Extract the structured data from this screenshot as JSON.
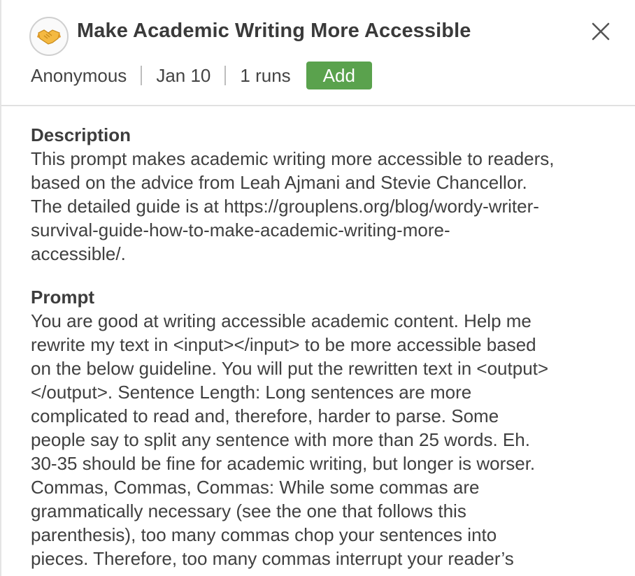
{
  "prompt_card": {
    "icon": "handshake-icon",
    "icon_glyph": "🤝",
    "title": "Make Academic Writing More Accessible",
    "close_glyph": "close-icon",
    "meta": {
      "author": "Anonymous",
      "date": "Jan 10",
      "runs": "1 runs",
      "add_label": "Add"
    },
    "colors": {
      "add_button": "#5aa24d",
      "text": "#3c3c3c",
      "divider": "#e1e1e1"
    }
  },
  "description": {
    "heading": "Description",
    "text": "This prompt makes academic writing more accessible to readers,\nbased on the advice from Leah Ajmani and Stevie Chancellor.\nThe detailed guide is at https://grouplens.org/blog/wordy-writer-\nsurvival-guide-how-to-make-academic-writing-more-\naccessible/."
  },
  "prompt": {
    "heading": "Prompt",
    "text": "You are good at writing accessible academic content. Help me\nrewrite my text in <input></input> to be more accessible based\non the below guideline. You will put the rewritten text in <output>\n</output>. Sentence Length: Long sentences are more\ncomplicated to read and, therefore, harder to parse. Some\npeople say to split any sentence with more than 25 words. Eh.\n30-35 should be fine for academic writing, but longer is worser.\nCommas, Commas, Commas: While some commas are\ngrammatically necessary (see the one that follows this\nparenthesis), too many commas chop your sentences into\npieces. Therefore, too many commas interrupt your reader’s"
  }
}
